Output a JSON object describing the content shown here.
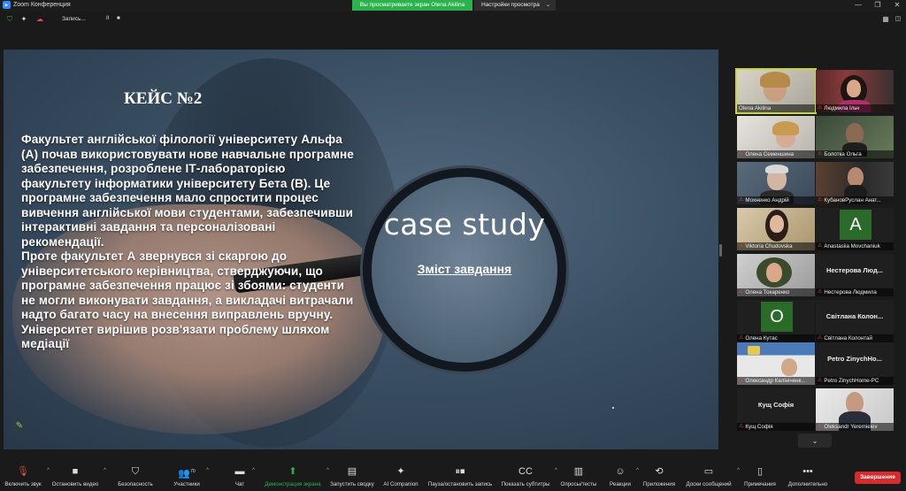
{
  "window": {
    "title": "Zoom Конференция",
    "share_banner": "Вы просматриваете экран Olena Akilina",
    "view_options": "Настройки просмотра",
    "minimize": "—",
    "restore": "❐",
    "close": "✕"
  },
  "subbar": {
    "recording_label": "Запись...",
    "pause": "II",
    "stop": "■"
  },
  "slide": {
    "title": "КЕЙС №2",
    "paragraphs": [
      "Факультет англійської філології університету Альфа (А) почав використовувати нове навчальне програмне забезпечення, розроблене ІТ-лабораторією факультету інформатики університету Бета (В). Це програмне забезпечення мало спростити процес вивчення англійської мови студентами, забезпечивши інтерактивні завдання та персоналізовані рекомендації.",
      "Проте факультет А звернувся зі скаргою до університетського керівництва, стверджуючи, що програмне забезпечення працює зі збоями: студенти не могли виконувати завдання, а викладачі витрачали надто багато часу на внесення виправлень вручну. Університет вирішив розв'язати проблему шляхом медіації"
    ],
    "lens_text": "case study",
    "link_text": "Зміст завдання"
  },
  "participants": [
    {
      "name": "Olena Akilina",
      "type": "video",
      "muted": false,
      "active": true
    },
    {
      "name": "Людмила Ільч",
      "type": "video",
      "muted": true
    },
    {
      "name": "Олена Семеншина",
      "type": "video",
      "muted": true
    },
    {
      "name": "Болотка Ольга",
      "type": "video",
      "muted": true
    },
    {
      "name": "Мохненко Андрій",
      "type": "video",
      "muted": true
    },
    {
      "name": "КубановРуслан Анат...",
      "type": "video",
      "muted": true
    },
    {
      "name": "Viktoria Chudovska",
      "type": "video",
      "muted": true
    },
    {
      "name": "Anastasiia Movchaniuk",
      "type": "letter",
      "letter": "A",
      "muted": true
    },
    {
      "name": "Олена Токаренко",
      "type": "video",
      "muted": true
    },
    {
      "name": "Нестерова Людмила",
      "type": "text",
      "display": "Нестерова Люд...",
      "muted": true
    },
    {
      "name": "Олена Кутас",
      "type": "letter",
      "letter": "О",
      "muted": true
    },
    {
      "name": "Світлана Колонтай",
      "type": "text",
      "display": "Світлана Колон...",
      "muted": true
    },
    {
      "name": "Олександр Калініченк...",
      "type": "video",
      "muted": true
    },
    {
      "name": "Petro ZinychHome-PC",
      "type": "text",
      "display": "Petro ZinychHo...",
      "muted": true
    },
    {
      "name": "Кущ Софія",
      "type": "text",
      "display": "Кущ Софія",
      "muted": true
    },
    {
      "name": "Oleksandr Yeremieiev",
      "type": "video",
      "muted": true
    }
  ],
  "toolbar": {
    "mic": "Включить звук",
    "video": "Остановить видео",
    "security": "Безопасность",
    "participants": "Участники",
    "participants_count": "70",
    "chat": "Чат",
    "share": "Демонстрация экрана",
    "summary": "Запустить сводку",
    "ai": "AI Companion",
    "pause_share": "Пауза/остановить запись",
    "captions": "Показать субтитры",
    "polls": "Опросы/тесты",
    "reactions": "Реакции",
    "apps": "Приложения",
    "messages": "Доски сообщений",
    "notes": "Примечания",
    "more": "Дополнительно",
    "end": "Завершение"
  },
  "colors": {
    "share_green": "#2bb24c",
    "active_border": "#c9d33a",
    "end_red": "#d62b2b",
    "zoom_blue": "#2d8cff"
  }
}
